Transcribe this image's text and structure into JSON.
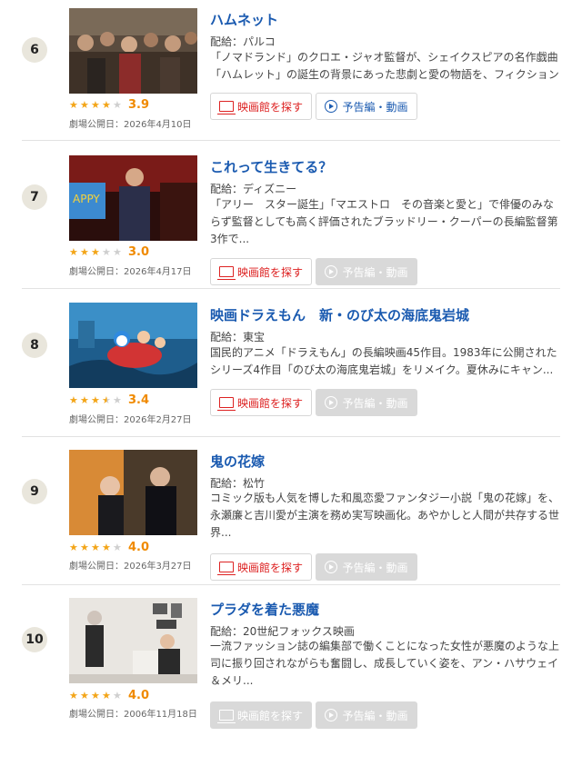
{
  "labels": {
    "theater_button": "映画館を探す",
    "trailer_button": "予告編・動画",
    "release_prefix": "劇場公開日：",
    "dist_prefix": "配給："
  },
  "colors": {
    "accent": "#1a5ab0",
    "star": "#f3a518",
    "score": "#f08a00",
    "theater": "#dd2222"
  },
  "items": [
    {
      "rank": "6",
      "title": "ハムネット",
      "distributor": "配給：パルコ",
      "description": "「ノマドランド」のクロエ・ジャオ監督が、シェイクスピアの名作戯曲「ハムレット」の誕生の背景にあった悲劇と愛の物語を、フィクションを交え...",
      "rating": 3.9,
      "score": "3.9",
      "release": "劇場公開日：2026年4月10日",
      "trailer_enabled": true,
      "theater_enabled": true,
      "thumb": "crowd-scene-image"
    },
    {
      "rank": "7",
      "title": "これって生きてる？",
      "distributor": "配給：ディズニー",
      "description": "「アリー　スター誕生」「マエストロ　その音楽と愛と」で俳優のみならず監督としても高く評価されたブラッドリー・クーパーの長編監督第3作で...",
      "rating": 3.0,
      "score": "3.0",
      "release": "劇場公開日：2026年4月17日",
      "trailer_enabled": false,
      "theater_enabled": true,
      "thumb": "comedian-stage-image"
    },
    {
      "rank": "8",
      "title": "映画ドラえもん　新・のび太の海底鬼岩城",
      "distributor": "配給：東宝",
      "description": "国民的アニメ「ドラえもん」の長編映画45作目。1983年に公開されたシリーズ4作目「のび太の海底鬼岩城」をリメイク。夏休みにキャン...",
      "rating": 3.4,
      "score": "3.4",
      "release": "劇場公開日：2026年2月27日",
      "trailer_enabled": false,
      "theater_enabled": true,
      "thumb": "underwater-anime-image"
    },
    {
      "rank": "9",
      "title": "鬼の花嫁",
      "distributor": "配給：松竹",
      "description": "コミック版も人気を博した和風恋愛ファンタジー小説「鬼の花嫁」を、永瀬廉と吉川愛が主演を務め実写映画化。あやかしと人間が共存する世界...",
      "rating": 4.0,
      "score": "4.0",
      "release": "劇場公開日：2026年3月27日",
      "trailer_enabled": false,
      "theater_enabled": true,
      "thumb": "couple-autumn-image"
    },
    {
      "rank": "10",
      "title": "プラダを着た悪魔",
      "distributor": "配給：20世紀フォックス映画",
      "description": "一流ファッション誌の編集部で働くことになった女性が悪魔のような上司に振り回されながらも奮闘し、成長していく姿を、アン・ハサウェイ＆メリ...",
      "rating": 4.0,
      "score": "4.0",
      "release": "劇場公開日：2006年11月18日",
      "trailer_enabled": false,
      "theater_enabled": false,
      "thumb": "office-scene-image"
    }
  ]
}
